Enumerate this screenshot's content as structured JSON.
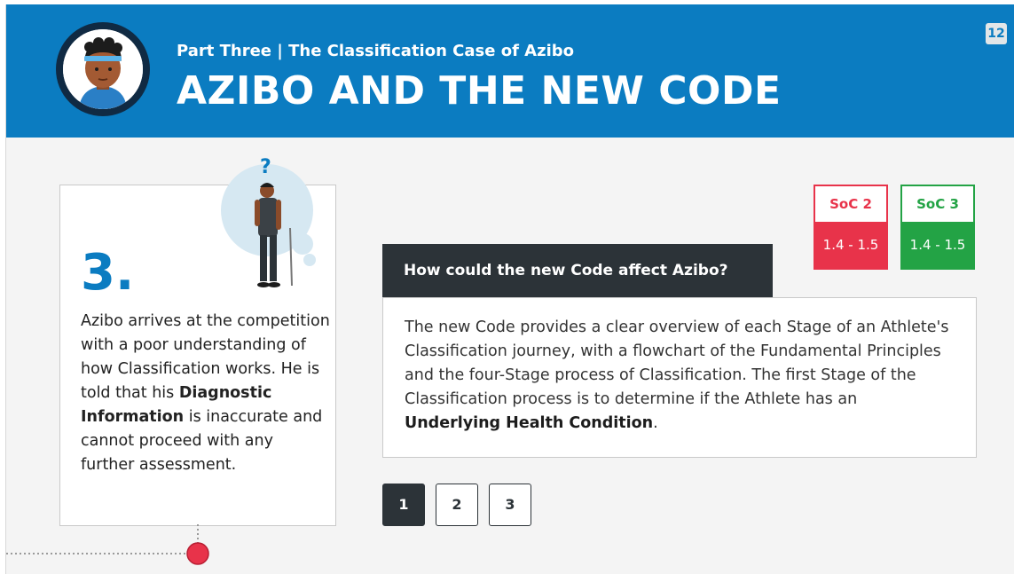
{
  "header": {
    "eyebrow": "Part Three | The Classification Case of Azibo",
    "title": "AZIBO AND THE NEW CODE",
    "page_number": "12"
  },
  "step": {
    "number": "3.",
    "text_1": "Azibo arrives at the competition with a poor understanding of how Classification works. He is told that his ",
    "bold_1": "Diagnostic Information",
    "text_2": " is inaccurate and cannot proceed with any further assessment."
  },
  "soc": [
    {
      "label": "SoC 2",
      "value": "1.4 - 1.5",
      "color": "#e8334a"
    },
    {
      "label": "SoC 3",
      "value": "1.4 - 1.5",
      "color": "#23a345"
    }
  ],
  "question": {
    "label": "How could the new Code affect Azibo?",
    "answer_1": "The new Code provides a clear overview of each Stage of an Athlete's Classification journey, with a flowchart of the Fundamental Principles and the four-Stage process of Classification. The first Stage of the Classification process is to determine if the Athlete has an ",
    "answer_bold": "Underlying Health Condition",
    "answer_2": "."
  },
  "pager": {
    "pages": [
      "1",
      "2",
      "3"
    ],
    "active": "1"
  },
  "colors": {
    "header_blue": "#0b7cc1",
    "dark": "#2c3338",
    "timeline_dot": "#e8334a"
  }
}
